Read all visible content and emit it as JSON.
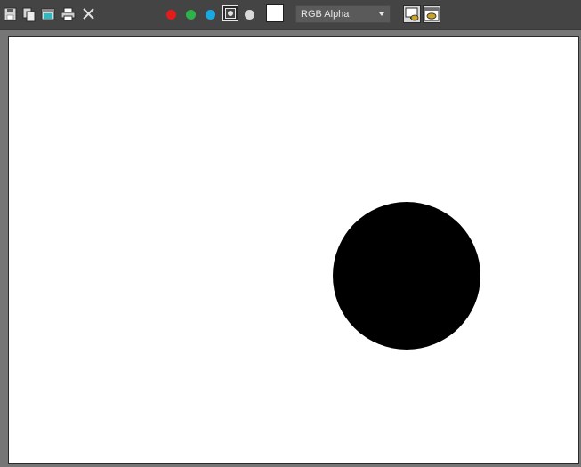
{
  "toolbar": {
    "icons": [
      "save-icon",
      "copy-icon",
      "clone-window-icon",
      "print-icon",
      "clear-icon"
    ],
    "channels": {
      "red": "#e21b1b",
      "green": "#2fb24a",
      "blue": "#19a9e0",
      "mono": "#d9d9d9"
    },
    "swatch_color": "#ffffff",
    "channel_display": {
      "selected": "RGB Alpha"
    }
  },
  "canvas": {
    "background": "#ffffff",
    "shape_color": "#000000"
  }
}
